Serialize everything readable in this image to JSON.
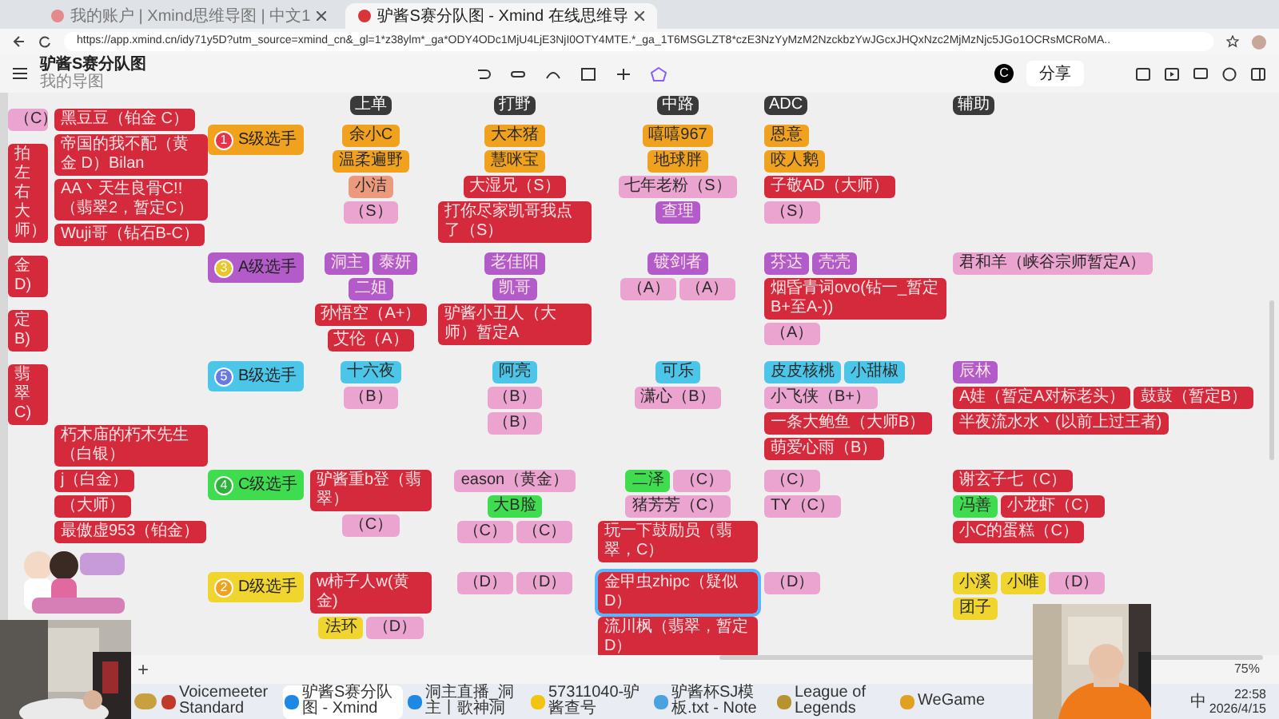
{
  "browser": {
    "tabs": [
      {
        "title": "我的账户 | Xmind思维导图 | 中文1",
        "selected": false
      },
      {
        "title": "驴酱S赛分队图 - Xmind 在线思维导",
        "selected": true
      }
    ],
    "url": "https://app.xmind.cn/idy71y5D?utm_source=xmind_cn&_gl=1*z38ylm*_ga*ODY4ODc1MjU4LjE3NjI0OTY4MTE.*_ga_1T6MSGLZT8*czE3NzYyMzM2NzckbzYwJGcxJHQxNzc2MjMzNjc5JGo1OCRsMCRoMA.."
  },
  "app": {
    "title": "驴酱S赛分队图",
    "subtitle": "我的导图",
    "avatar": "C",
    "share": "分享",
    "add_sheet": "+",
    "zoom": "75%"
  },
  "map": {
    "lanes": [
      "上单",
      "打野",
      "中路",
      "ADC",
      "辅助"
    ],
    "edge": [
      {
        "text": "（C）",
        "color": "#eba3cf"
      },
      {
        "text": "拍左右大师）",
        "color": "#d42a3c"
      },
      {
        "text": "金 D)",
        "color": "#d42a3c"
      },
      {
        "text": "定B)",
        "color": "#d42a3c"
      },
      {
        "text": "翡翠C)",
        "color": "#d42a3c"
      }
    ],
    "side_top": [
      {
        "text": "黑豆豆（铂金 C）",
        "color": "#d42a3c"
      },
      {
        "text": "帝国的我不配（黄金 D）Bilan",
        "color": "#d42a3c"
      },
      {
        "text": "AA丶天生良骨C!!（翡翠2，暂定C）",
        "color": "#d42a3c"
      },
      {
        "text": "Wuji哥（钻石B-C）",
        "color": "#d42a3c"
      }
    ],
    "side_bottom": [
      {
        "text": "朽木庙的朽木先生（白银）",
        "color": "#d42a3c"
      },
      {
        "text": "j（白金）",
        "color": "#d42a3c"
      },
      {
        "text": "（大师）",
        "color": "#d42a3c"
      },
      {
        "text": "最傲虚953（铂金）",
        "color": "#d42a3c"
      }
    ],
    "tiers": [
      {
        "title": "S级选手",
        "color": "#f0a21e",
        "badge": {
          "text": "1",
          "color": "#e8334a"
        },
        "top": [
          [
            {
              "text": "余小C",
              "color": "#f0a21e",
              "selected": false
            }
          ],
          [
            {
              "text": "温柔遍野",
              "color": "#f0a21e",
              "selected": false
            }
          ],
          [
            {
              "text": "小洁",
              "color": "#ec9a7e",
              "selected": false
            }
          ],
          [
            {
              "text": "（S）",
              "color": "#eba3cf",
              "selected": false
            }
          ]
        ],
        "jungle": [
          [
            {
              "text": "大本猪",
              "color": "#f0a21e",
              "selected": false
            }
          ],
          [
            {
              "text": "慧咪宝",
              "color": "#f0a21e",
              "selected": false
            }
          ],
          [
            {
              "text": "大湿兄（S）",
              "color": "#d42a3c",
              "selected": false
            }
          ],
          [
            {
              "text": "打你尽家凯哥我点了（S）",
              "color": "#d42a3c",
              "selected": false
            }
          ]
        ],
        "mid": [
          [
            {
              "text": "嘻嘻967",
              "color": "#f0a21e",
              "selected": false
            }
          ],
          [
            {
              "text": "地球胖",
              "color": "#f0a21e",
              "selected": false
            }
          ],
          [
            {
              "text": "七年老粉（S）",
              "color": "#eba3cf",
              "selected": false
            }
          ],
          [
            {
              "text": "查理",
              "color": "#b35cc9",
              "selected": false
            }
          ]
        ],
        "adc": [
          [
            {
              "text": "恩意",
              "color": "#f0a21e",
              "selected": false
            }
          ],
          [
            {
              "text": "咬人鹅",
              "color": "#f0a21e",
              "selected": false
            }
          ],
          [
            {
              "text": "子敬AD（大师）",
              "color": "#d42a3c",
              "selected": false
            }
          ],
          [
            {
              "text": "（S）",
              "color": "#eba3cf",
              "selected": false
            }
          ]
        ]
      },
      {
        "title": "A级选手",
        "color": "#b35cc9",
        "badge": {
          "text": "3",
          "color": "#e8c62a"
        },
        "top": [
          [
            {
              "text": "洞主",
              "color": "#b35cc9",
              "selected": false
            },
            {
              "text": "泰妍",
              "color": "#b35cc9",
              "selected": false
            },
            {
              "text": "二姐",
              "color": "#b35cc9",
              "selected": false
            }
          ],
          [
            {
              "text": "孙悟空（A+）",
              "color": "#d42a3c",
              "selected": false
            }
          ],
          [
            {
              "text": "艾伦（A）",
              "color": "#d42a3c",
              "selected": false
            }
          ]
        ],
        "jungle": [
          [
            {
              "text": "老佳阳",
              "color": "#b35cc9",
              "selected": false
            }
          ],
          [
            {
              "text": "凯哥",
              "color": "#b35cc9",
              "selected": false
            }
          ],
          [
            {
              "text": "驴酱小丑人（大师）暂定A",
              "color": "#d42a3c",
              "selected": false
            }
          ]
        ],
        "mid": [
          [
            {
              "text": "镀剑者",
              "color": "#b35cc9",
              "selected": false
            }
          ],
          [
            {
              "text": "（A）",
              "color": "#eba3cf",
              "selected": false
            },
            {
              "text": "（A）",
              "color": "#eba3cf",
              "selected": false
            }
          ]
        ],
        "adc": [
          [
            {
              "text": "芬达",
              "color": "#b35cc9",
              "selected": false
            },
            {
              "text": "壳壳",
              "color": "#b35cc9",
              "selected": false
            }
          ],
          [
            {
              "text": "烟昏青词ovo(钻一_暂定B+至A-))",
              "color": "#d42a3c",
              "selected": false
            }
          ],
          [
            {
              "text": "（A）",
              "color": "#eba3cf",
              "selected": false
            }
          ]
        ],
        "support": [
          [
            {
              "text": "君和羊（峡谷宗师暂定A）",
              "color": "#eba3cf",
              "selected": false
            }
          ]
        ]
      },
      {
        "title": "B级选手",
        "color": "#4cc6e8",
        "badge": {
          "text": "5",
          "color": "#6a7be0"
        },
        "top": [
          [
            {
              "text": "十六夜",
              "color": "#4cc6e8",
              "selected": false
            }
          ],
          [
            {
              "text": "（B）",
              "color": "#eba3cf",
              "selected": false
            }
          ]
        ],
        "jungle": [
          [
            {
              "text": "阿亮",
              "color": "#4cc6e8",
              "selected": false
            }
          ],
          [
            {
              "text": "（B）",
              "color": "#eba3cf",
              "selected": false
            }
          ],
          [
            {
              "text": "（B）",
              "color": "#eba3cf",
              "selected": false
            }
          ]
        ],
        "mid": [
          [
            {
              "text": "可乐",
              "color": "#4cc6e8",
              "selected": false
            }
          ],
          [
            {
              "text": "潇心（B）",
              "color": "#eba3cf",
              "selected": false
            }
          ]
        ],
        "adc": [
          [
            {
              "text": "皮皮核桃",
              "color": "#4cc6e8",
              "selected": false
            },
            {
              "text": "小甜椒",
              "color": "#4cc6e8",
              "selected": false
            }
          ],
          [
            {
              "text": "小飞侠（B+）",
              "color": "#eba3cf",
              "selected": false
            }
          ],
          [
            {
              "text": "一条大鲍鱼（大师B）",
              "color": "#d42a3c",
              "selected": false
            }
          ],
          [
            {
              "text": "萌爱心雨（B）",
              "color": "#d42a3c",
              "selected": false
            }
          ]
        ],
        "support": [
          [
            {
              "text": "辰林",
              "color": "#b35cc9",
              "selected": false
            }
          ],
          [
            {
              "text": "A娃（暂定A对标老头）",
              "color": "#d42a3c",
              "selected": false
            },
            {
              "text": "鼓鼓（暂定B）",
              "color": "#d42a3c",
              "selected": false
            }
          ],
          [
            {
              "text": "半夜流水水丶(以前上过王者)",
              "color": "#d42a3c",
              "selected": false
            }
          ]
        ]
      },
      {
        "title": "C级选手",
        "color": "#3fdc4f",
        "badge": {
          "text": "4",
          "color": "#2fb23c"
        },
        "top": [
          [
            {
              "text": "驴酱重b登（翡翠）",
              "color": "#d42a3c",
              "selected": false
            }
          ],
          [
            {
              "text": "（C）",
              "color": "#eba3cf",
              "selected": false
            }
          ]
        ],
        "jungle": [
          [
            {
              "text": "eason（黄金）",
              "color": "#eba3cf",
              "selected": false
            }
          ],
          [
            {
              "text": "大B脸",
              "color": "#3fdc4f",
              "selected": false
            }
          ],
          [
            {
              "text": "（C）",
              "color": "#eba3cf",
              "selected": false
            },
            {
              "text": "（C）",
              "color": "#eba3cf",
              "selected": false
            }
          ]
        ],
        "mid": [
          [
            {
              "text": "二泽",
              "color": "#3fdc4f",
              "selected": false
            },
            {
              "text": "（C）",
              "color": "#eba3cf",
              "selected": false
            }
          ],
          [
            {
              "text": "猪芳芳（C）",
              "color": "#eba3cf",
              "selected": false
            }
          ],
          [
            {
              "text": "玩一下鼓励员（翡翠，C）",
              "color": "#d42a3c",
              "selected": false
            }
          ]
        ],
        "adc": [
          [
            {
              "text": "（C）",
              "color": "#eba3cf",
              "selected": false
            }
          ],
          [
            {
              "text": "TY（C）",
              "color": "#eba3cf",
              "selected": false
            }
          ]
        ],
        "support": [
          [
            {
              "text": "谢玄子七（C）",
              "color": "#d42a3c",
              "selected": false
            }
          ],
          [
            {
              "text": "冯善",
              "color": "#3fdc4f",
              "selected": false
            },
            {
              "text": "小龙虾（C）",
              "color": "#d42a3c",
              "selected": false
            }
          ],
          [
            {
              "text": "小C的蛋糕（C）",
              "color": "#d42a3c",
              "selected": false
            }
          ]
        ]
      },
      {
        "title": "D级选手",
        "color": "#f1d52f",
        "badge": {
          "text": "2",
          "color": "#f0a21e"
        },
        "top": [
          [
            {
              "text": "w柿子人w(黄金)",
              "color": "#d42a3c",
              "selected": false
            }
          ],
          [
            {
              "text": "法环",
              "color": "#f1d52f",
              "selected": false
            },
            {
              "text": "（D）",
              "color": "#eba3cf",
              "selected": false
            }
          ]
        ],
        "jungle": [
          [
            {
              "text": "（D）",
              "color": "#eba3cf",
              "selected": false
            },
            {
              "text": "（D）",
              "color": "#eba3cf",
              "selected": false
            }
          ]
        ],
        "mid": [
          [
            {
              "text": "金甲虫zhipc（疑似D）",
              "color": "#d42a3c",
              "selected": true
            }
          ],
          [
            {
              "text": "流川枫（翡翠，暂定D）",
              "color": "#d42a3c",
              "selected": false
            }
          ]
        ],
        "adc": [
          [
            {
              "text": "（D）",
              "color": "#eba3cf",
              "selected": false
            }
          ]
        ],
        "support": [
          [
            {
              "text": "小溪",
              "color": "#f1d52f",
              "selected": false
            },
            {
              "text": "小唯",
              "color": "#f1d52f",
              "selected": false
            },
            {
              "text": "（D）",
              "color": "#eba3cf",
              "selected": false
            }
          ],
          [
            {
              "text": "团子",
              "color": "#f1d52f",
              "selected": false
            }
          ]
        ]
      }
    ]
  },
  "taskbar": {
    "apps": [
      {
        "label": "Voicemeeter Standard",
        "color": "#c0392b",
        "selected": false
      },
      {
        "label": "驴酱S赛分队图 - Xmind",
        "color": "#1e88e5",
        "selected": true
      },
      {
        "label": "洞主直播_洞主丨歌神洞",
        "color": "#1e88e5",
        "selected": false
      },
      {
        "label": "57311040-驴酱查号",
        "color": "#f1c40f",
        "selected": false
      },
      {
        "label": "驴酱杯SJ模板.txt - Note",
        "color": "#4aa3df",
        "selected": false
      },
      {
        "label": "League of Legends",
        "color": "#b8922e",
        "selected": false
      },
      {
        "label": "WeGame",
        "color": "#e0a020",
        "selected": false
      }
    ],
    "ime": "中",
    "time": "22:58",
    "date": "2026/4/15"
  }
}
